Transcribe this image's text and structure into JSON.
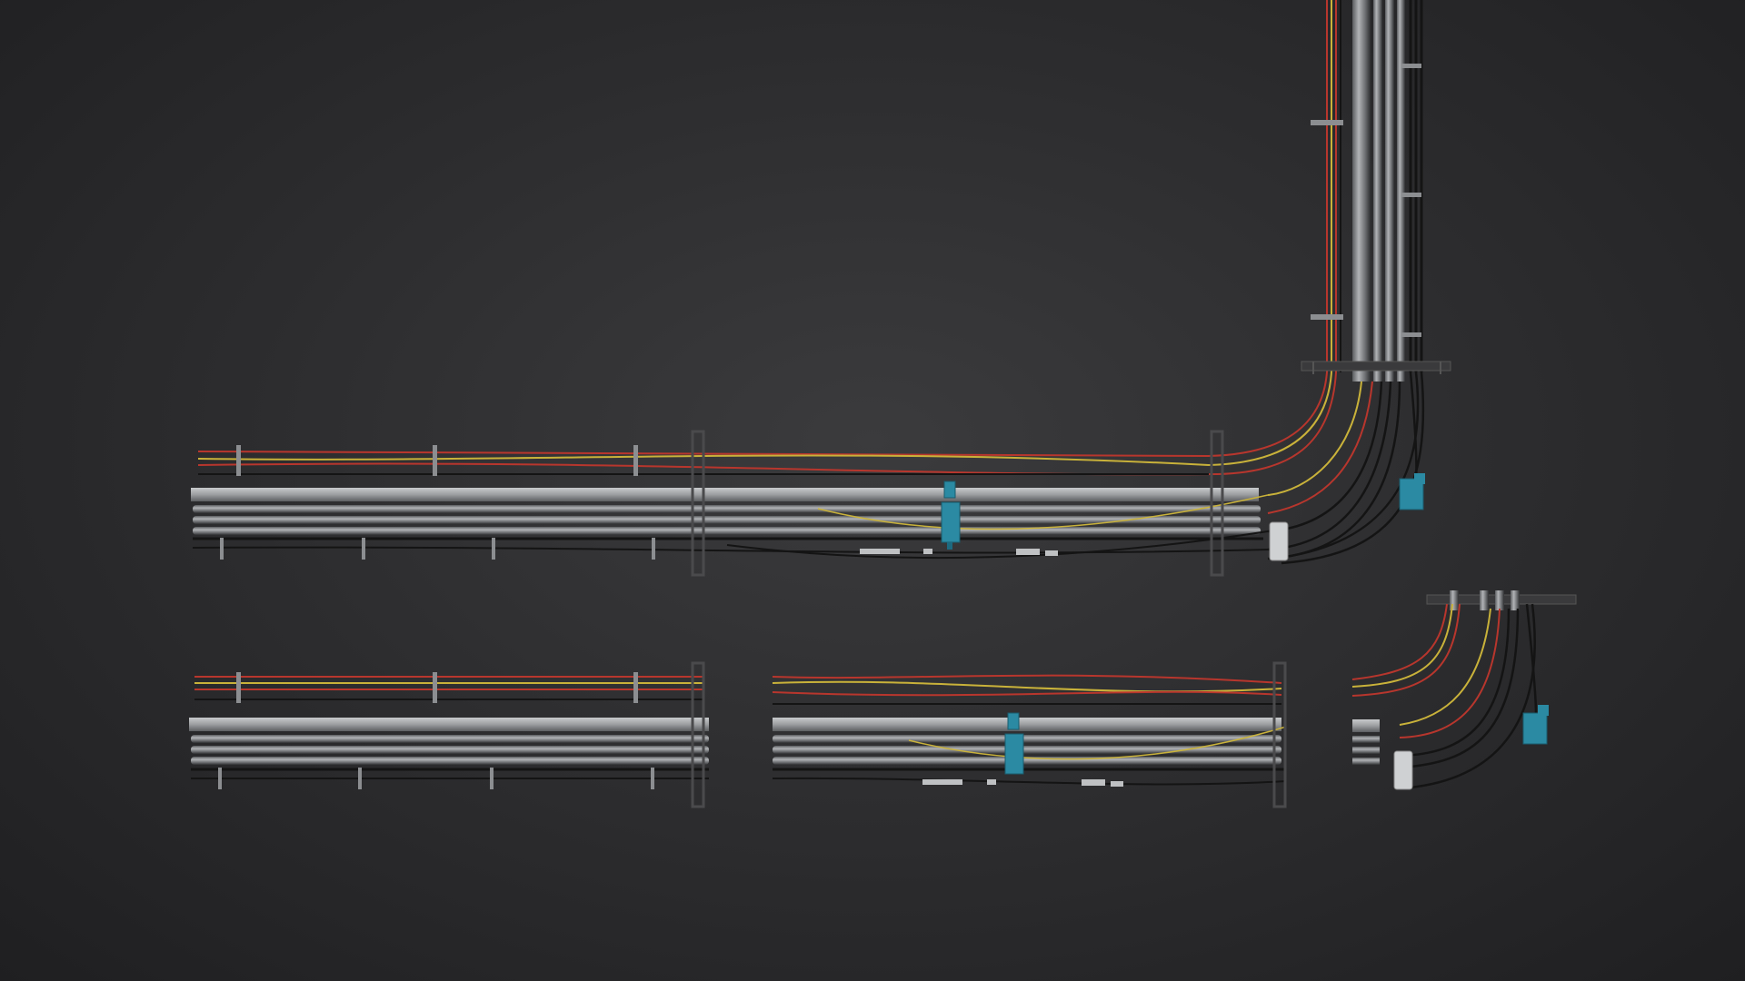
{
  "scene": {
    "background_color": "#2c2c2e",
    "subject": "cable-tray-kit",
    "pieces": [
      {
        "id": "corner-assembly",
        "parts": [
          "straight-run",
          "vertical-riser",
          "bend"
        ]
      },
      {
        "id": "straight-segment"
      },
      {
        "id": "junction-segment"
      },
      {
        "id": "bend-segment"
      }
    ],
    "colors": {
      "wire_red": "#b8362d",
      "wire_yellow": "#c9b23a",
      "wire_black": "#141414",
      "conduit": "#8d8f92",
      "tray_rail": "#9a9c9f",
      "junction_box": "#2b8aa3",
      "bracket": "#4a4a4c"
    }
  }
}
